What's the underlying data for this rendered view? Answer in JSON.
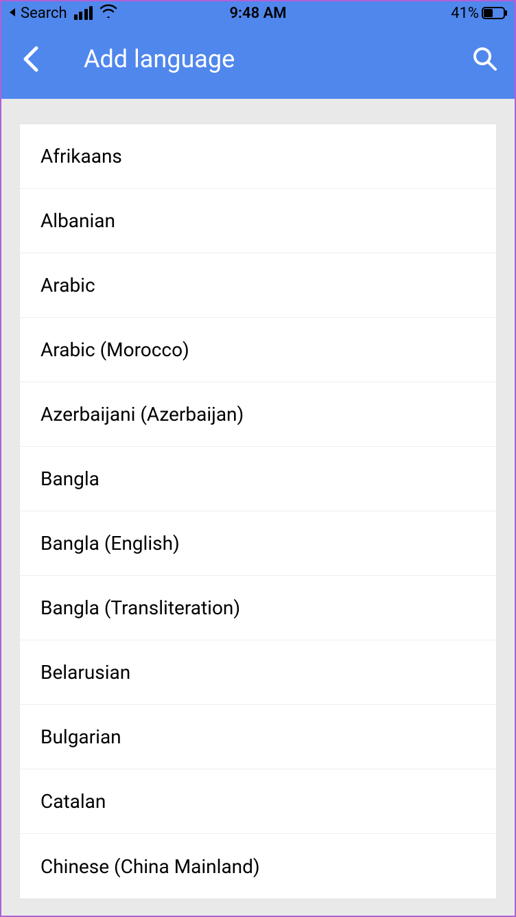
{
  "status_bar": {
    "back_app": "Search",
    "time": "9:48 AM",
    "battery_percent": "41%"
  },
  "nav": {
    "title": "Add language"
  },
  "languages": [
    "Afrikaans",
    "Albanian",
    "Arabic",
    "Arabic (Morocco)",
    "Azerbaijani (Azerbaijan)",
    "Bangla",
    "Bangla (English)",
    "Bangla (Transliteration)",
    "Belarusian",
    "Bulgarian",
    "Catalan",
    "Chinese (China Mainland)"
  ]
}
